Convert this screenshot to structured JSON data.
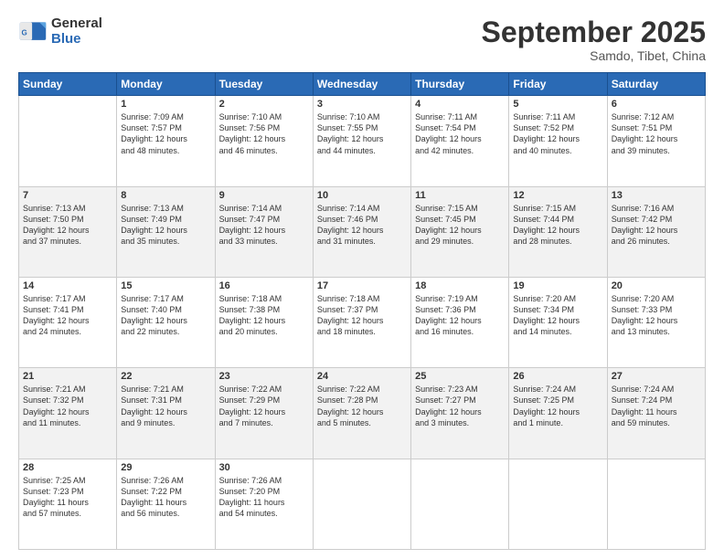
{
  "logo": {
    "general": "General",
    "blue": "Blue"
  },
  "header": {
    "month": "September 2025",
    "location": "Samdo, Tibet, China"
  },
  "days_of_week": [
    "Sunday",
    "Monday",
    "Tuesday",
    "Wednesday",
    "Thursday",
    "Friday",
    "Saturday"
  ],
  "weeks": [
    [
      {
        "day": "",
        "content": ""
      },
      {
        "day": "1",
        "content": "Sunrise: 7:09 AM\nSunset: 7:57 PM\nDaylight: 12 hours\nand 48 minutes."
      },
      {
        "day": "2",
        "content": "Sunrise: 7:10 AM\nSunset: 7:56 PM\nDaylight: 12 hours\nand 46 minutes."
      },
      {
        "day": "3",
        "content": "Sunrise: 7:10 AM\nSunset: 7:55 PM\nDaylight: 12 hours\nand 44 minutes."
      },
      {
        "day": "4",
        "content": "Sunrise: 7:11 AM\nSunset: 7:54 PM\nDaylight: 12 hours\nand 42 minutes."
      },
      {
        "day": "5",
        "content": "Sunrise: 7:11 AM\nSunset: 7:52 PM\nDaylight: 12 hours\nand 40 minutes."
      },
      {
        "day": "6",
        "content": "Sunrise: 7:12 AM\nSunset: 7:51 PM\nDaylight: 12 hours\nand 39 minutes."
      }
    ],
    [
      {
        "day": "7",
        "content": "Sunrise: 7:13 AM\nSunset: 7:50 PM\nDaylight: 12 hours\nand 37 minutes."
      },
      {
        "day": "8",
        "content": "Sunrise: 7:13 AM\nSunset: 7:49 PM\nDaylight: 12 hours\nand 35 minutes."
      },
      {
        "day": "9",
        "content": "Sunrise: 7:14 AM\nSunset: 7:47 PM\nDaylight: 12 hours\nand 33 minutes."
      },
      {
        "day": "10",
        "content": "Sunrise: 7:14 AM\nSunset: 7:46 PM\nDaylight: 12 hours\nand 31 minutes."
      },
      {
        "day": "11",
        "content": "Sunrise: 7:15 AM\nSunset: 7:45 PM\nDaylight: 12 hours\nand 29 minutes."
      },
      {
        "day": "12",
        "content": "Sunrise: 7:15 AM\nSunset: 7:44 PM\nDaylight: 12 hours\nand 28 minutes."
      },
      {
        "day": "13",
        "content": "Sunrise: 7:16 AM\nSunset: 7:42 PM\nDaylight: 12 hours\nand 26 minutes."
      }
    ],
    [
      {
        "day": "14",
        "content": "Sunrise: 7:17 AM\nSunset: 7:41 PM\nDaylight: 12 hours\nand 24 minutes."
      },
      {
        "day": "15",
        "content": "Sunrise: 7:17 AM\nSunset: 7:40 PM\nDaylight: 12 hours\nand 22 minutes."
      },
      {
        "day": "16",
        "content": "Sunrise: 7:18 AM\nSunset: 7:38 PM\nDaylight: 12 hours\nand 20 minutes."
      },
      {
        "day": "17",
        "content": "Sunrise: 7:18 AM\nSunset: 7:37 PM\nDaylight: 12 hours\nand 18 minutes."
      },
      {
        "day": "18",
        "content": "Sunrise: 7:19 AM\nSunset: 7:36 PM\nDaylight: 12 hours\nand 16 minutes."
      },
      {
        "day": "19",
        "content": "Sunrise: 7:20 AM\nSunset: 7:34 PM\nDaylight: 12 hours\nand 14 minutes."
      },
      {
        "day": "20",
        "content": "Sunrise: 7:20 AM\nSunset: 7:33 PM\nDaylight: 12 hours\nand 13 minutes."
      }
    ],
    [
      {
        "day": "21",
        "content": "Sunrise: 7:21 AM\nSunset: 7:32 PM\nDaylight: 12 hours\nand 11 minutes."
      },
      {
        "day": "22",
        "content": "Sunrise: 7:21 AM\nSunset: 7:31 PM\nDaylight: 12 hours\nand 9 minutes."
      },
      {
        "day": "23",
        "content": "Sunrise: 7:22 AM\nSunset: 7:29 PM\nDaylight: 12 hours\nand 7 minutes."
      },
      {
        "day": "24",
        "content": "Sunrise: 7:22 AM\nSunset: 7:28 PM\nDaylight: 12 hours\nand 5 minutes."
      },
      {
        "day": "25",
        "content": "Sunrise: 7:23 AM\nSunset: 7:27 PM\nDaylight: 12 hours\nand 3 minutes."
      },
      {
        "day": "26",
        "content": "Sunrise: 7:24 AM\nSunset: 7:25 PM\nDaylight: 12 hours\nand 1 minute."
      },
      {
        "day": "27",
        "content": "Sunrise: 7:24 AM\nSunset: 7:24 PM\nDaylight: 11 hours\nand 59 minutes."
      }
    ],
    [
      {
        "day": "28",
        "content": "Sunrise: 7:25 AM\nSunset: 7:23 PM\nDaylight: 11 hours\nand 57 minutes."
      },
      {
        "day": "29",
        "content": "Sunrise: 7:26 AM\nSunset: 7:22 PM\nDaylight: 11 hours\nand 56 minutes."
      },
      {
        "day": "30",
        "content": "Sunrise: 7:26 AM\nSunset: 7:20 PM\nDaylight: 11 hours\nand 54 minutes."
      },
      {
        "day": "",
        "content": ""
      },
      {
        "day": "",
        "content": ""
      },
      {
        "day": "",
        "content": ""
      },
      {
        "day": "",
        "content": ""
      }
    ]
  ]
}
